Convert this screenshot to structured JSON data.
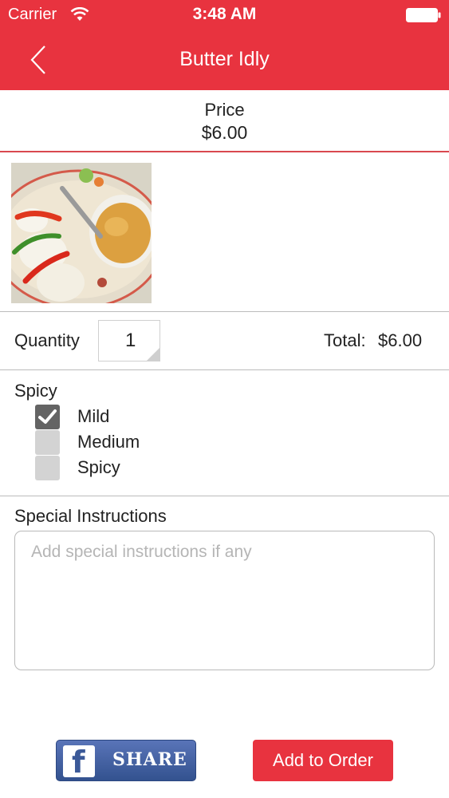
{
  "status_bar": {
    "carrier": "Carrier",
    "time": "3:48 AM"
  },
  "nav": {
    "title": "Butter Idly"
  },
  "price": {
    "label": "Price",
    "value": "$6.00"
  },
  "quantity": {
    "label": "Quantity",
    "value": "1",
    "total_label": "Total:",
    "total_value": "$6.00"
  },
  "spicy": {
    "title": "Spicy",
    "options": [
      {
        "label": "Mild",
        "checked": true
      },
      {
        "label": "Medium",
        "checked": false
      },
      {
        "label": "Spicy",
        "checked": false
      }
    ]
  },
  "instructions": {
    "title": "Special Instructions",
    "placeholder": "Add special instructions if any"
  },
  "actions": {
    "share_label": "SHARE",
    "facebook_glyph": "f",
    "add_label": "Add to Order"
  },
  "colors": {
    "accent": "#e8333f",
    "facebook": "#3b5998",
    "checked_box": "#646464",
    "unchecked_box": "#d3d3d3"
  },
  "icons": {
    "back": "chevron-left-icon",
    "wifi": "wifi-icon",
    "battery": "battery-icon",
    "check": "check-icon",
    "facebook": "facebook-icon"
  }
}
